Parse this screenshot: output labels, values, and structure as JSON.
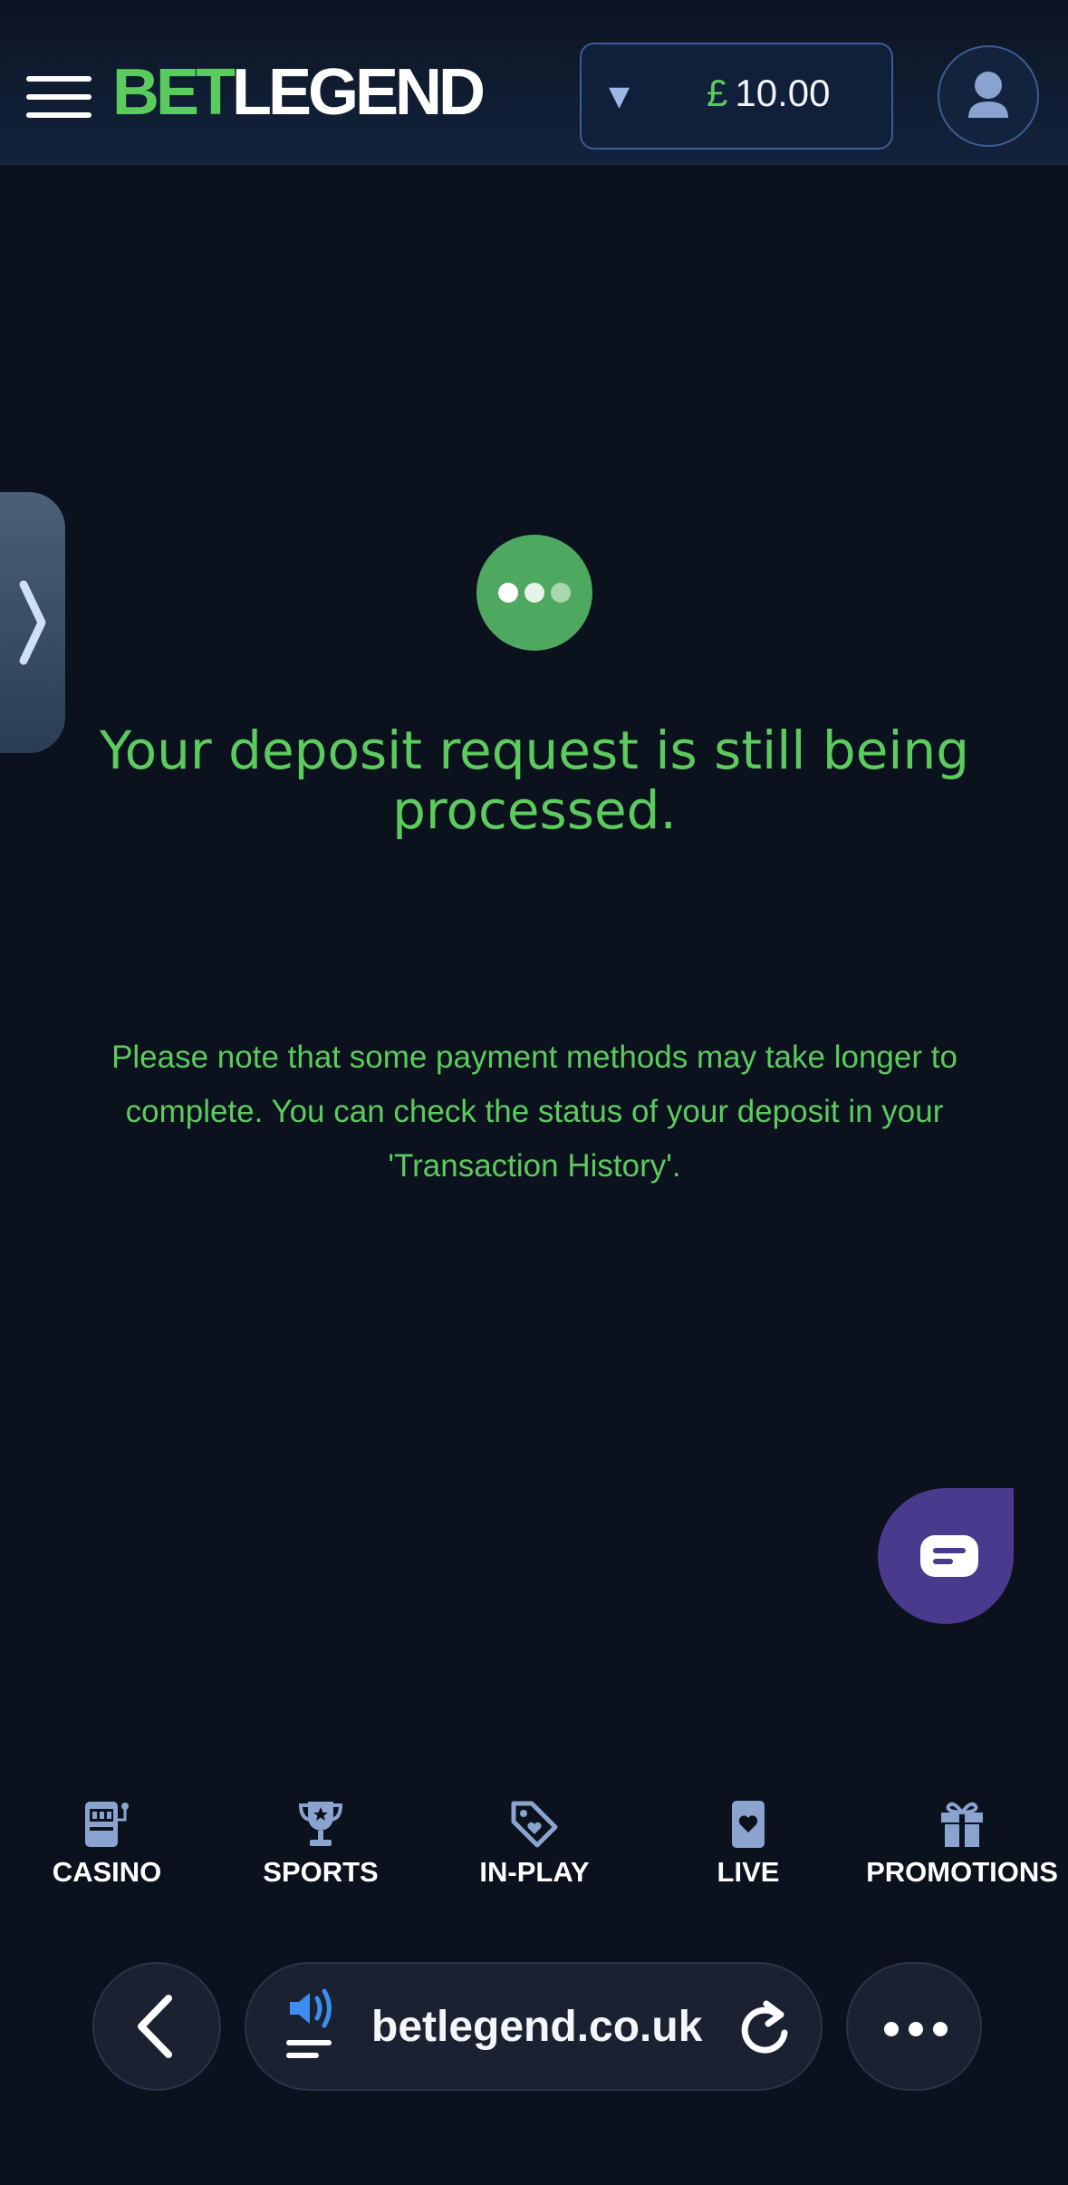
{
  "header": {
    "logo_part1": "BET",
    "logo_part2": "LEGEND",
    "balance_currency": "£",
    "balance_value": "10.00"
  },
  "status": {
    "title": "Your deposit request is still being processed.",
    "note": "Please note that some payment methods may take longer to complete. You can check the status of your deposit in your 'Transaction History'."
  },
  "bottom_nav": {
    "items": [
      {
        "label": "CASINO",
        "icon": "slot-machine-icon"
      },
      {
        "label": "SPORTS",
        "icon": "trophy-icon"
      },
      {
        "label": "IN-PLAY",
        "icon": "tag-icon"
      },
      {
        "label": "LIVE",
        "icon": "playing-card-icon"
      },
      {
        "label": "PROMOTIONS",
        "icon": "gift-icon"
      }
    ]
  },
  "browser": {
    "url": "betlegend.co.uk"
  },
  "colors": {
    "background": "#0b111d",
    "accent_green": "#5ccb5e",
    "chat_purple": "#4a3a8e",
    "icon_blue": "#8aa3cf"
  }
}
